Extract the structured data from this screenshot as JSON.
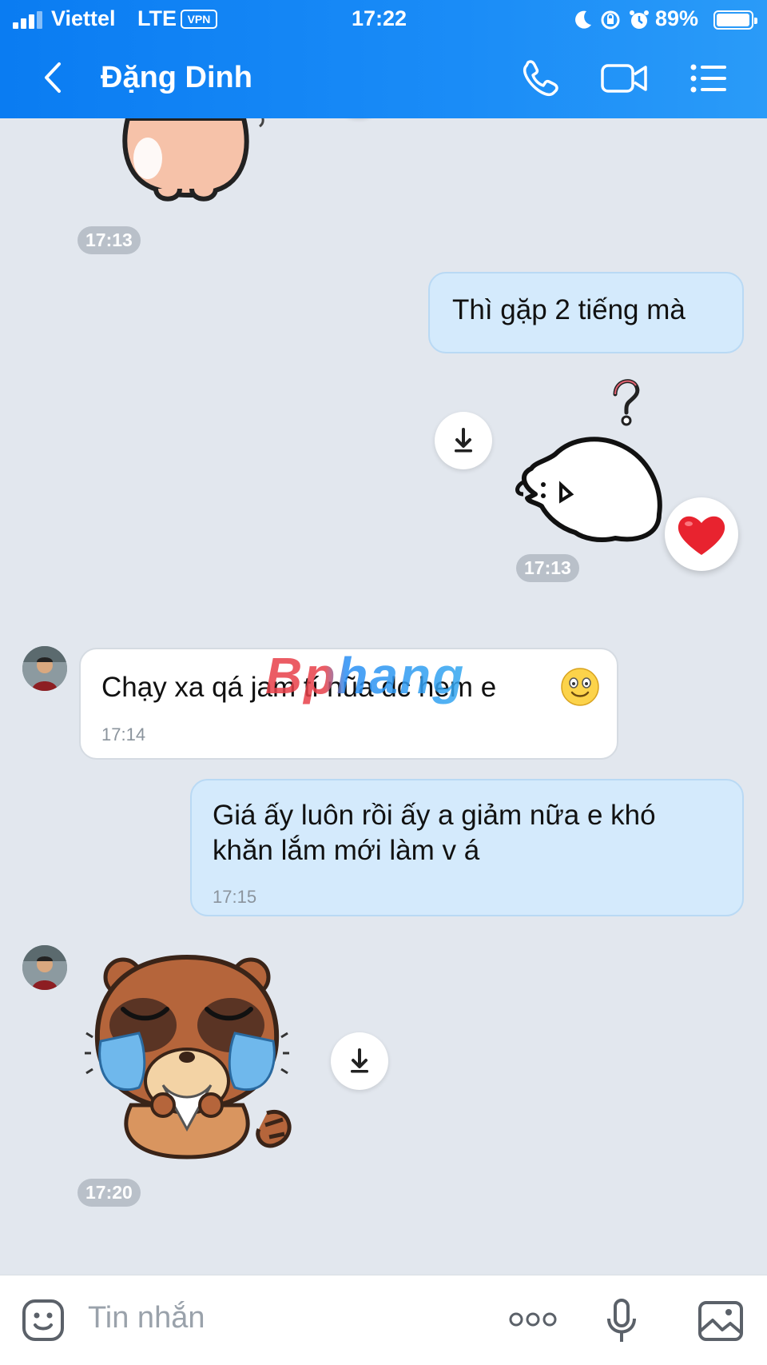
{
  "status_bar": {
    "carrier": "Viettel",
    "network": "LTE",
    "vpn": "VPN",
    "time": "17:22",
    "battery": "89%",
    "battery_level": 0.89
  },
  "header": {
    "contact_name": "Đặng Dinh",
    "icons": [
      "back-icon",
      "phone-icon",
      "video-call-icon",
      "menu-icon"
    ]
  },
  "messages": [
    {
      "type": "sticker",
      "direction": "in",
      "time": "17:13"
    },
    {
      "type": "text",
      "direction": "out",
      "text": "Thì gặp 2 tiếng mà"
    },
    {
      "type": "sticker",
      "direction": "out",
      "time": "17:13",
      "reaction": "heart"
    },
    {
      "type": "text",
      "direction": "in",
      "text": "Chạy xa qá jam tí nũa dc hem e",
      "time": "17:14"
    },
    {
      "type": "text",
      "direction": "out",
      "text_line1": "Giá ấy luôn rồi ấy a giảm nữa e khó",
      "text_line2": "khăn lắm mới làm v á",
      "time": "17:15"
    },
    {
      "type": "sticker",
      "direction": "in",
      "time": "17:20"
    }
  ],
  "watermark": "Bphang",
  "input_bar": {
    "placeholder": "Tin nhắn",
    "more": "ooo"
  },
  "colors": {
    "header": "#0a7cf2",
    "chat_bg": "#e2e7ee",
    "out_bubble": "#d4eafc",
    "in_bubble": "#ffffff",
    "heart": "#e8232f"
  }
}
